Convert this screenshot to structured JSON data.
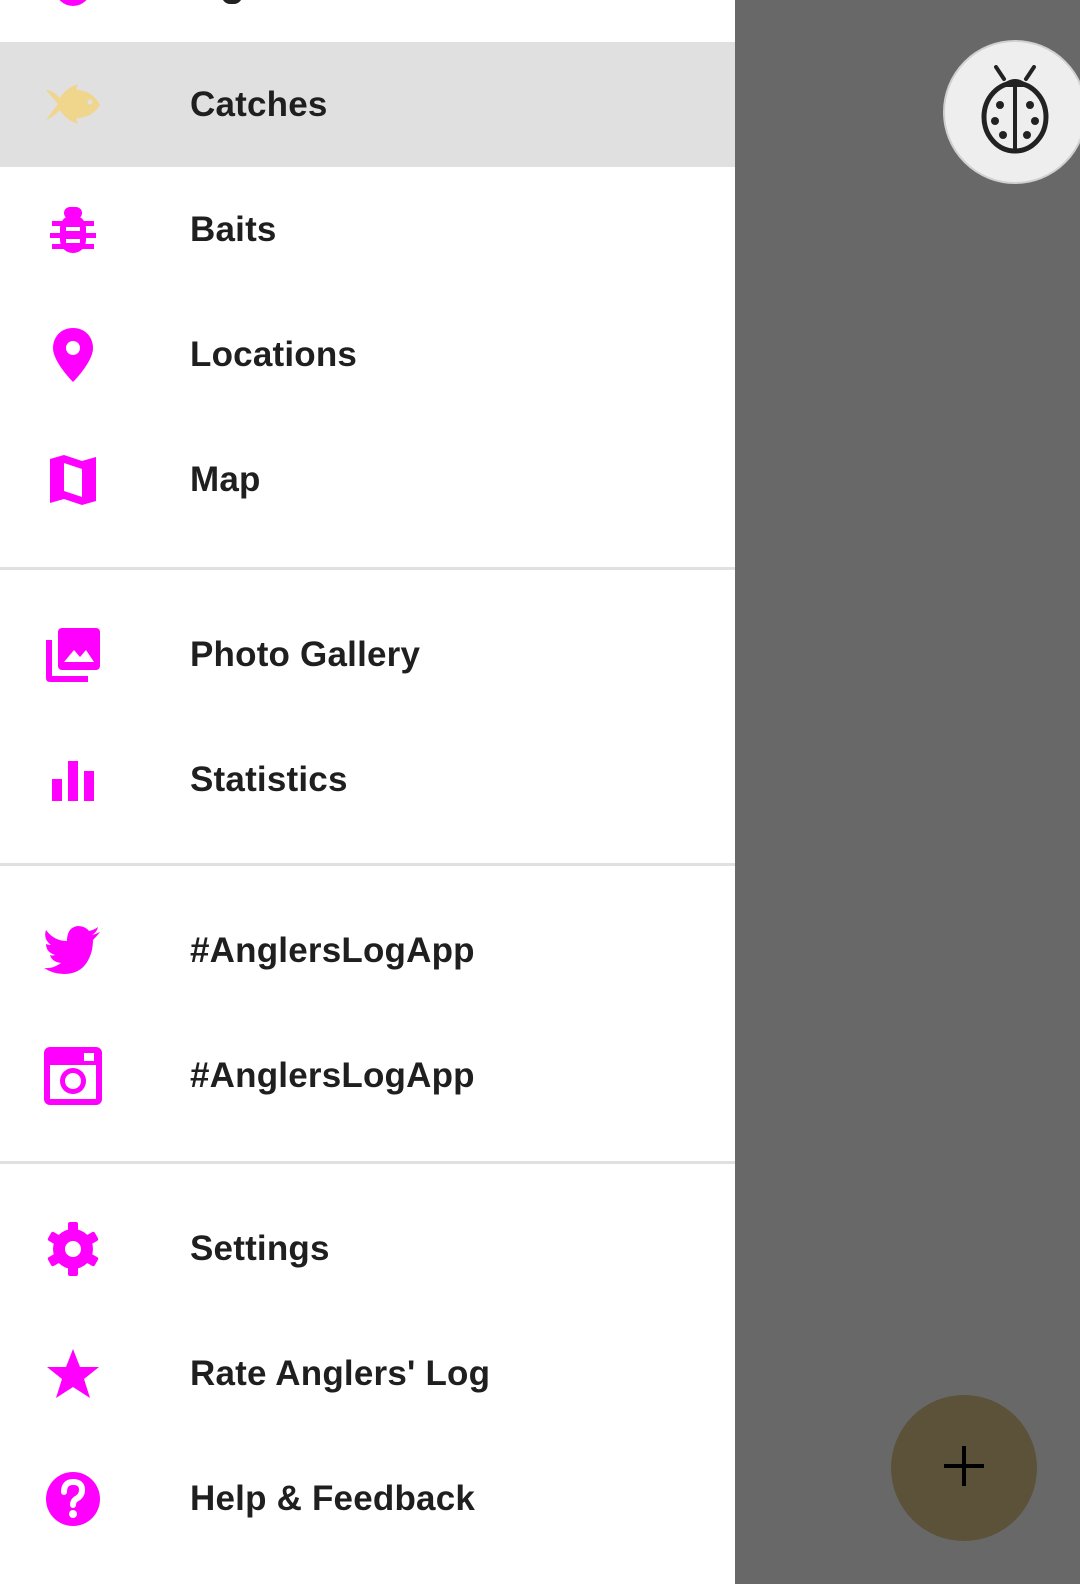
{
  "theme": {
    "accent": "#ff00ff",
    "selected_icon_color": "#f0d58c",
    "selected_background": "#e0e0e0",
    "scrim": "#686868",
    "fab_background": "#5c523a"
  },
  "drawer": {
    "items": [
      {
        "id": "catches",
        "label": "Catches",
        "icon": "fish-icon",
        "selected": true
      },
      {
        "id": "baits",
        "label": "Baits",
        "icon": "bug-icon"
      },
      {
        "id": "locations",
        "label": "Locations",
        "icon": "location-pin-icon"
      },
      {
        "id": "map",
        "label": "Map",
        "icon": "map-icon"
      },
      {
        "id": "photo-gallery",
        "label": "Photo Gallery",
        "icon": "photo-library-icon"
      },
      {
        "id": "statistics",
        "label": "Statistics",
        "icon": "bar-chart-icon"
      },
      {
        "id": "twitter",
        "label": "#AnglersLogApp",
        "icon": "twitter-icon"
      },
      {
        "id": "instagram",
        "label": "#AnglersLogApp",
        "icon": "instagram-icon"
      },
      {
        "id": "settings",
        "label": "Settings",
        "icon": "gear-icon"
      },
      {
        "id": "rate",
        "label": "Rate Anglers' Log",
        "icon": "star-icon"
      },
      {
        "id": "help",
        "label": "Help & Feedback",
        "icon": "help-icon"
      }
    ]
  },
  "fab": {
    "bug_report_icon": "ladybug-icon",
    "add_icon": "plus-icon"
  }
}
